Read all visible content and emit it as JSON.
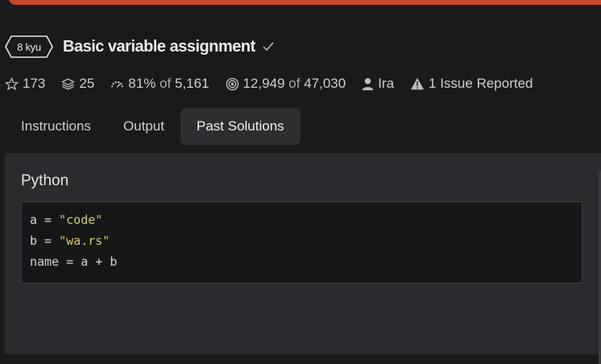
{
  "kata": {
    "rank": "8 kyu",
    "title": "Basic variable assignment"
  },
  "stats": {
    "stars": "173",
    "collections": "25",
    "satisfaction": "81%",
    "satisfaction_of": "of",
    "satisfaction_votes": "5,161",
    "completed": "12,949",
    "completed_of": "of",
    "attempted": "47,030",
    "author": "Ira",
    "issues": "1 Issue Reported"
  },
  "tabs": [
    {
      "label": "Instructions"
    },
    {
      "label": "Output"
    },
    {
      "label": "Past Solutions"
    }
  ],
  "active_tab": "Past Solutions",
  "solution": {
    "language": "Python",
    "lines": [
      {
        "code": "a = ",
        "string": "\"code\""
      },
      {
        "code": "b = ",
        "string": "\"wa.rs\""
      },
      {
        "code": "name = a + b",
        "string": ""
      }
    ]
  },
  "colors": {
    "accent_bar": "#c6452c",
    "background": "#1a1a1c",
    "panel": "#2a2b2e",
    "string_literal": "#d6c87a"
  },
  "icons": [
    "kyu-hexagon-icon",
    "check-icon",
    "star-icon",
    "stack-icon",
    "gauge-icon",
    "target-icon",
    "user-icon",
    "warning-icon"
  ]
}
